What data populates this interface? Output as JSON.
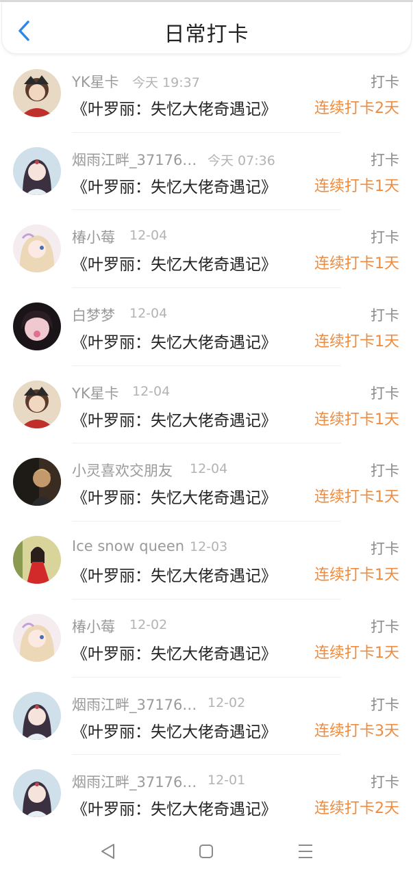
{
  "header": {
    "title": "日常打卡",
    "back_icon": "chevron-left-icon"
  },
  "colors": {
    "accent": "#2f86e8",
    "streak": "#f08a3c",
    "name": "#9a9a9a",
    "time": "#b3b3b3",
    "book": "#222222"
  },
  "entries": [
    {
      "name": "YK星卡",
      "time": "今天 19:37",
      "action": "打卡",
      "book": "《叶罗丽：失忆大佬奇遇记》",
      "streak": "连续打卡2天"
    },
    {
      "name": "烟雨江畔_37176…",
      "time": "今天 07:36",
      "action": "打卡",
      "book": "《叶罗丽：失忆大佬奇遇记》",
      "streak": "连续打卡1天"
    },
    {
      "name": "椿小莓",
      "time": "12-04",
      "action": "打卡",
      "book": "《叶罗丽：失忆大佬奇遇记》",
      "streak": "连续打卡1天"
    },
    {
      "name": "白梦梦",
      "time": "12-04",
      "action": "打卡",
      "book": "《叶罗丽：失忆大佬奇遇记》",
      "streak": "连续打卡1天"
    },
    {
      "name": "YK星卡",
      "time": "12-04",
      "action": "打卡",
      "book": "《叶罗丽：失忆大佬奇遇记》",
      "streak": "连续打卡1天"
    },
    {
      "name": "小灵喜欢交朋友",
      "time": "12-04",
      "action": "打卡",
      "book": "《叶罗丽：失忆大佬奇遇记》",
      "streak": "连续打卡1天"
    },
    {
      "name": "Ice snow queen",
      "time": "12-03",
      "action": "打卡",
      "book": "《叶罗丽：失忆大佬奇遇记》",
      "streak": "连续打卡1天"
    },
    {
      "name": "椿小莓",
      "time": "12-02",
      "action": "打卡",
      "book": "《叶罗丽：失忆大佬奇遇记》",
      "streak": "连续打卡1天"
    },
    {
      "name": "烟雨江畔_37176…",
      "time": "12-02",
      "action": "打卡",
      "book": "《叶罗丽：失忆大佬奇遇记》",
      "streak": "连续打卡3天"
    },
    {
      "name": "烟雨江畔_37176…",
      "time": "12-01",
      "action": "打卡",
      "book": "《叶罗丽：失忆大佬奇遇记》",
      "streak": "连续打卡2天"
    }
  ],
  "navbar": {
    "back_icon": "triangle-back-icon",
    "home_icon": "square-home-icon",
    "menu_icon": "hamburger-menu-icon"
  }
}
